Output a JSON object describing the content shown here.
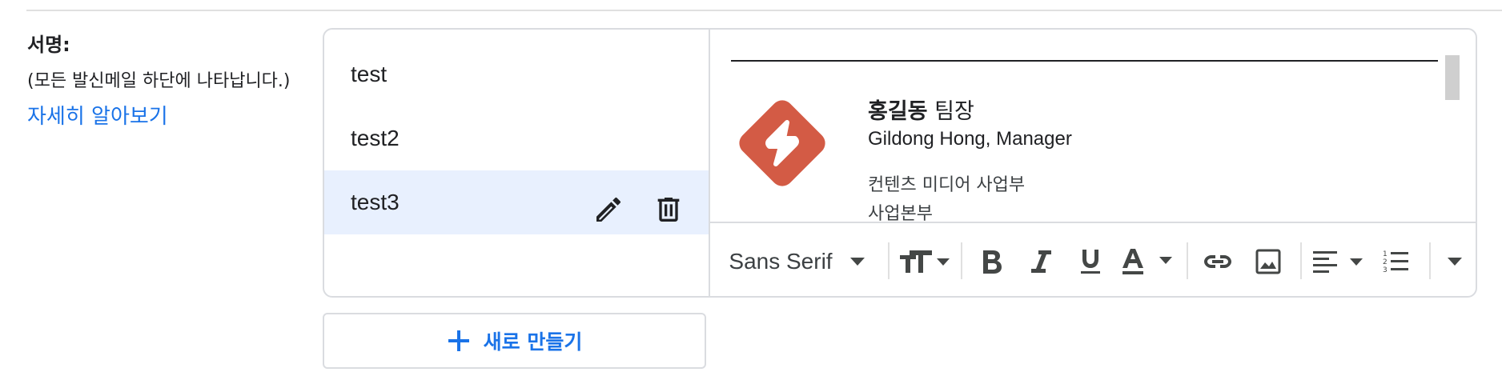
{
  "label": {
    "title": "서명:",
    "subtitle": "(모든 발신메일 하단에 나타납니다.)",
    "learn_more": "자세히 알아보기"
  },
  "signatures": [
    {
      "name": "test",
      "selected": false
    },
    {
      "name": "test2",
      "selected": false
    },
    {
      "name": "test3",
      "selected": true
    }
  ],
  "preview": {
    "name_bold": "홍길동",
    "name_rest": " 팀장",
    "english": "Gildong Hong, Manager",
    "department": "컨텐츠 미디어 사업부",
    "cut_line": "사업본부",
    "logo_color": "#d35b45"
  },
  "toolbar": {
    "font": "Sans Serif",
    "icons": [
      "font-dropdown",
      "text-size-icon",
      "bold-icon",
      "italic-icon",
      "underline-icon",
      "text-color-icon",
      "link-icon",
      "image-icon",
      "align-icon",
      "numbered-list-icon",
      "more-options-icon"
    ]
  },
  "new_button": {
    "label": "새로 만들기",
    "color": "#1a73e8"
  }
}
